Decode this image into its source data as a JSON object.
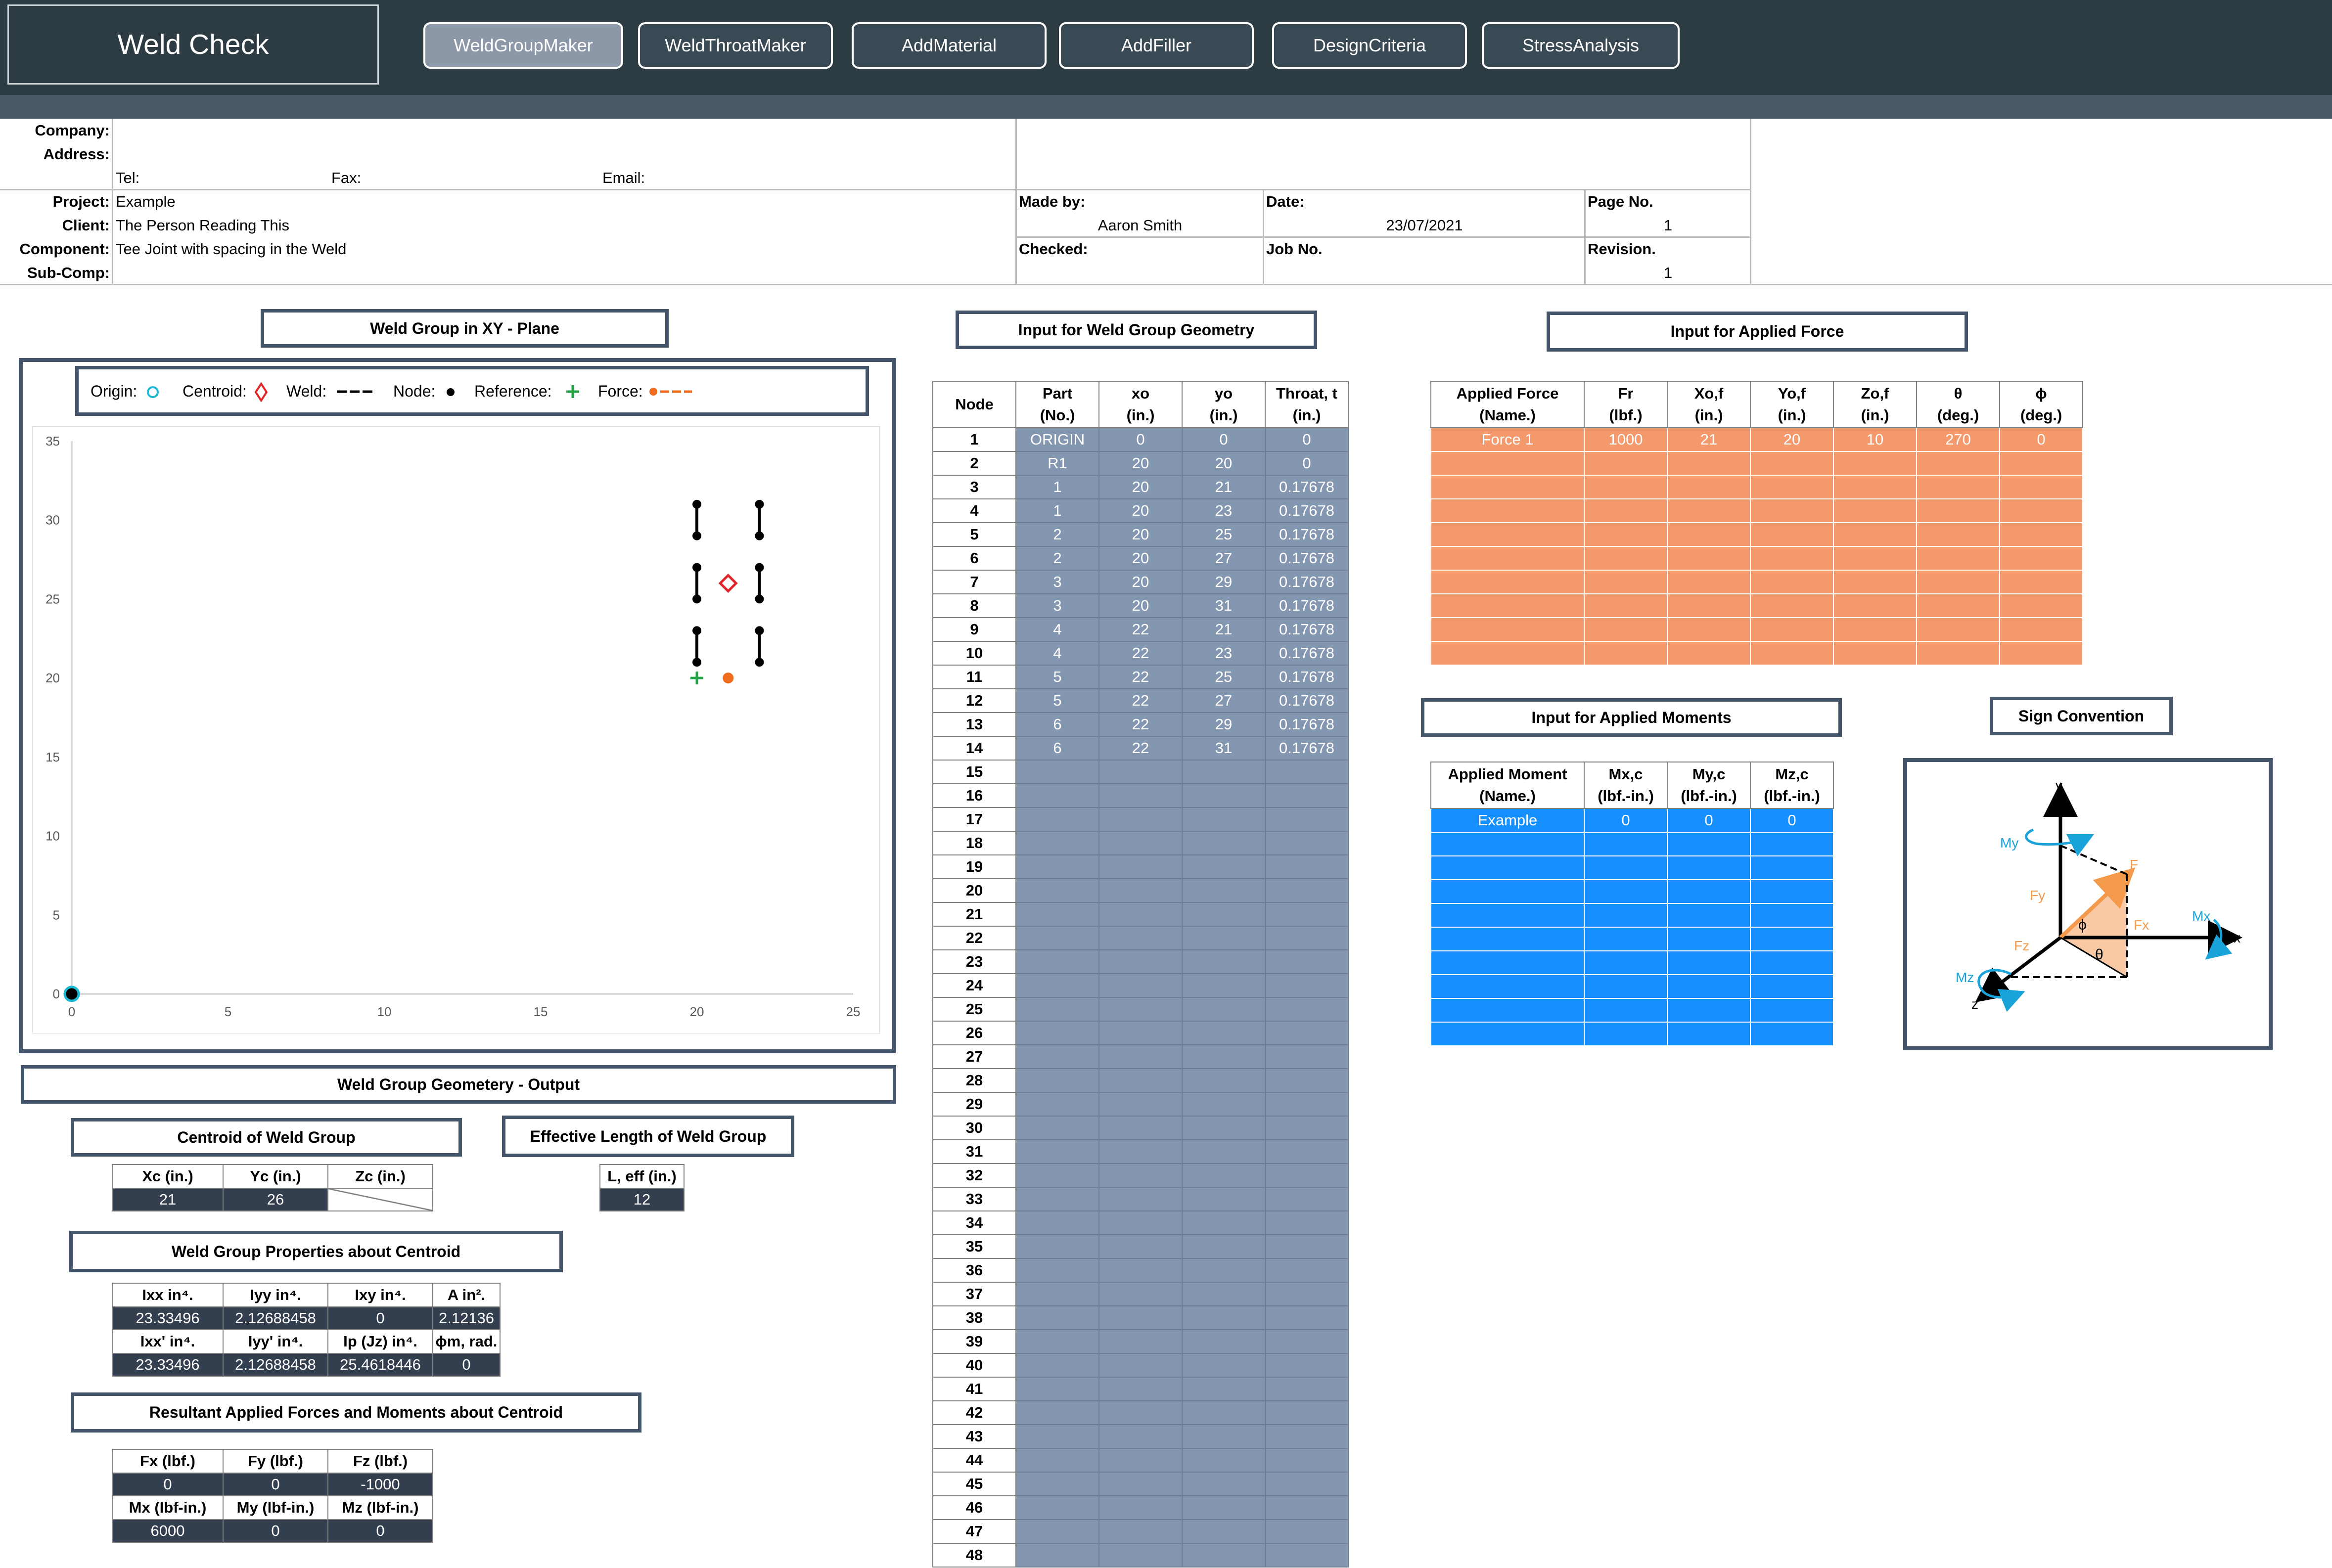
{
  "app": {
    "title": "Weld Check",
    "nav": [
      {
        "label": "WeldGroupMaker",
        "active": true
      },
      {
        "label": "WeldThroatMaker"
      },
      {
        "label": "AddMaterial"
      },
      {
        "label": "AddFiller"
      },
      {
        "label": "DesignCriteria"
      },
      {
        "label": "StressAnalysis"
      }
    ]
  },
  "info": {
    "company_label": "Company:",
    "address_label": "Address:",
    "tel_label": "Tel:",
    "fax_label": "Fax:",
    "email_label": "Email:",
    "project_label": "Project:",
    "project": "Example",
    "client_label": "Client:",
    "client": "The Person Reading This",
    "component_label": "Component:",
    "component": "Tee Joint with spacing in the Weld",
    "subcomp_label": "Sub-Comp:",
    "made_by_label": "Made by:",
    "made_by": "Aaron Smith",
    "date_label": "Date:",
    "date": "23/07/2021",
    "page_label": "Page No.",
    "page": "1",
    "checked_label": "Checked:",
    "job_label": "Job No.",
    "revision_label": "Revision.",
    "revision": "1"
  },
  "plot": {
    "title": "Weld Group in XY - Plane",
    "legend": {
      "origin": "Origin:",
      "centroid": "Centroid:",
      "weld": "Weld:",
      "node": "Node:",
      "reference": "Reference:",
      "force": "Force:"
    },
    "x_ticks": [
      "0",
      "5",
      "10",
      "15",
      "20",
      "25"
    ],
    "y_ticks": [
      "0",
      "5",
      "10",
      "15",
      "20",
      "25",
      "30",
      "35"
    ]
  },
  "chart_data": {
    "type": "scatter",
    "xlim": [
      0,
      25
    ],
    "ylim": [
      0,
      35
    ],
    "x_ticks": [
      0,
      5,
      10,
      15,
      20,
      25
    ],
    "y_ticks": [
      0,
      5,
      10,
      15,
      20,
      25,
      30,
      35
    ],
    "grid": false,
    "welds": [
      [
        [
          20,
          21
        ],
        [
          20,
          23
        ]
      ],
      [
        [
          20,
          25
        ],
        [
          20,
          27
        ]
      ],
      [
        [
          20,
          29
        ],
        [
          20,
          31
        ]
      ],
      [
        [
          22,
          21
        ],
        [
          22,
          23
        ]
      ],
      [
        [
          22,
          25
        ],
        [
          22,
          27
        ]
      ],
      [
        [
          22,
          29
        ],
        [
          22,
          31
        ]
      ]
    ],
    "origin": [
      0,
      0
    ],
    "centroid": [
      21,
      26
    ],
    "reference": [
      20,
      20
    ],
    "force_point": [
      21,
      20
    ],
    "colors": {
      "weld": "#000000",
      "centroid": "#e0262b",
      "reference": "#22a447",
      "force": "#ee6c1b",
      "origin": "#1db9d3"
    }
  },
  "geometry": {
    "title": "Input for Weld Group Geometry",
    "headers": [
      [
        "Node",
        ""
      ],
      [
        "Part",
        "(No.)"
      ],
      [
        "xo",
        "(in.)"
      ],
      [
        "yo",
        "(in.)"
      ],
      [
        "Throat, t",
        "(in.)"
      ]
    ],
    "rows": [
      [
        "1",
        "ORIGIN",
        "0",
        "0",
        "0"
      ],
      [
        "2",
        "R1",
        "20",
        "20",
        "0"
      ],
      [
        "3",
        "1",
        "20",
        "21",
        "0.17678"
      ],
      [
        "4",
        "1",
        "20",
        "23",
        "0.17678"
      ],
      [
        "5",
        "2",
        "20",
        "25",
        "0.17678"
      ],
      [
        "6",
        "2",
        "20",
        "27",
        "0.17678"
      ],
      [
        "7",
        "3",
        "20",
        "29",
        "0.17678"
      ],
      [
        "8",
        "3",
        "20",
        "31",
        "0.17678"
      ],
      [
        "9",
        "4",
        "22",
        "21",
        "0.17678"
      ],
      [
        "10",
        "4",
        "22",
        "23",
        "0.17678"
      ],
      [
        "11",
        "5",
        "22",
        "25",
        "0.17678"
      ],
      [
        "12",
        "5",
        "22",
        "27",
        "0.17678"
      ],
      [
        "13",
        "6",
        "22",
        "29",
        "0.17678"
      ],
      [
        "14",
        "6",
        "22",
        "31",
        "0.17678"
      ]
    ],
    "node_count": 48
  },
  "force": {
    "title": "Input for Applied Force",
    "headers": [
      [
        "Applied Force",
        "(Name.)"
      ],
      [
        "Fr",
        "(lbf.)"
      ],
      [
        "Xo,f",
        "(in.)"
      ],
      [
        "Yo,f",
        "(in.)"
      ],
      [
        "Zo,f",
        "(in.)"
      ],
      [
        "θ",
        "(deg.)"
      ],
      [
        "ϕ",
        "(deg.)"
      ]
    ],
    "rows": [
      [
        "Force 1",
        "1000",
        "21",
        "20",
        "10",
        "270",
        "0"
      ]
    ]
  },
  "moments": {
    "title": "Input for Applied Moments",
    "headers": [
      [
        "Applied Moment",
        "(Name.)"
      ],
      [
        "Mx,c",
        "(lbf.-in.)"
      ],
      [
        "My,c",
        "(lbf.-in.)"
      ],
      [
        "Mz,c",
        "(lbf.-in.)"
      ]
    ],
    "rows": [
      [
        "Example",
        "0",
        "0",
        "0"
      ]
    ]
  },
  "sign": {
    "title": "Sign Convention",
    "labels": {
      "y": "y",
      "x": "x",
      "z": "z",
      "My": "My",
      "Mx": "Mx",
      "Mz": "Mz",
      "F": "F",
      "Fy": "Fy",
      "Fx": "Fx",
      "Fz": "Fz",
      "phi": "ϕ",
      "theta": "θ"
    }
  },
  "output": {
    "title": "Weld Group Geometery - Output",
    "centroid_title": "Centroid of Weld Group",
    "centroid_headers": [
      "Xc (in.)",
      "Yc (in.)",
      "Zc (in.)"
    ],
    "centroid_values": [
      "21",
      "26"
    ],
    "length_title": "Effective Length of Weld Group",
    "length_header": "L, eff (in.)",
    "length_value": "12",
    "props_title": "Weld Group Properties about Centroid",
    "props_headers1": [
      "Ixx in⁴.",
      "Iyy in⁴.",
      "Ixy in⁴.",
      "A in²."
    ],
    "props_values1": [
      "23.33496",
      "2.12688458",
      "0",
      "2.12136"
    ],
    "props_headers2": [
      "Ixx' in⁴.",
      "Iyy' in⁴.",
      "Ip (Jz) in⁴.",
      "ϕm, rad."
    ],
    "props_values2": [
      "23.33496",
      "2.12688458",
      "25.4618446",
      "0"
    ],
    "res_title": "Resultant Applied Forces and Moments about Centroid",
    "res_headers1": [
      "Fx (lbf.)",
      "Fy (lbf.)",
      "Fz (lbf.)"
    ],
    "res_values1": [
      "0",
      "0",
      "-1000"
    ],
    "res_headers2": [
      "Mx (lbf-in.)",
      "My (lbf-in.)",
      "Mz (lbf-in.)"
    ],
    "res_values2": [
      "6000",
      "0",
      "0"
    ]
  }
}
